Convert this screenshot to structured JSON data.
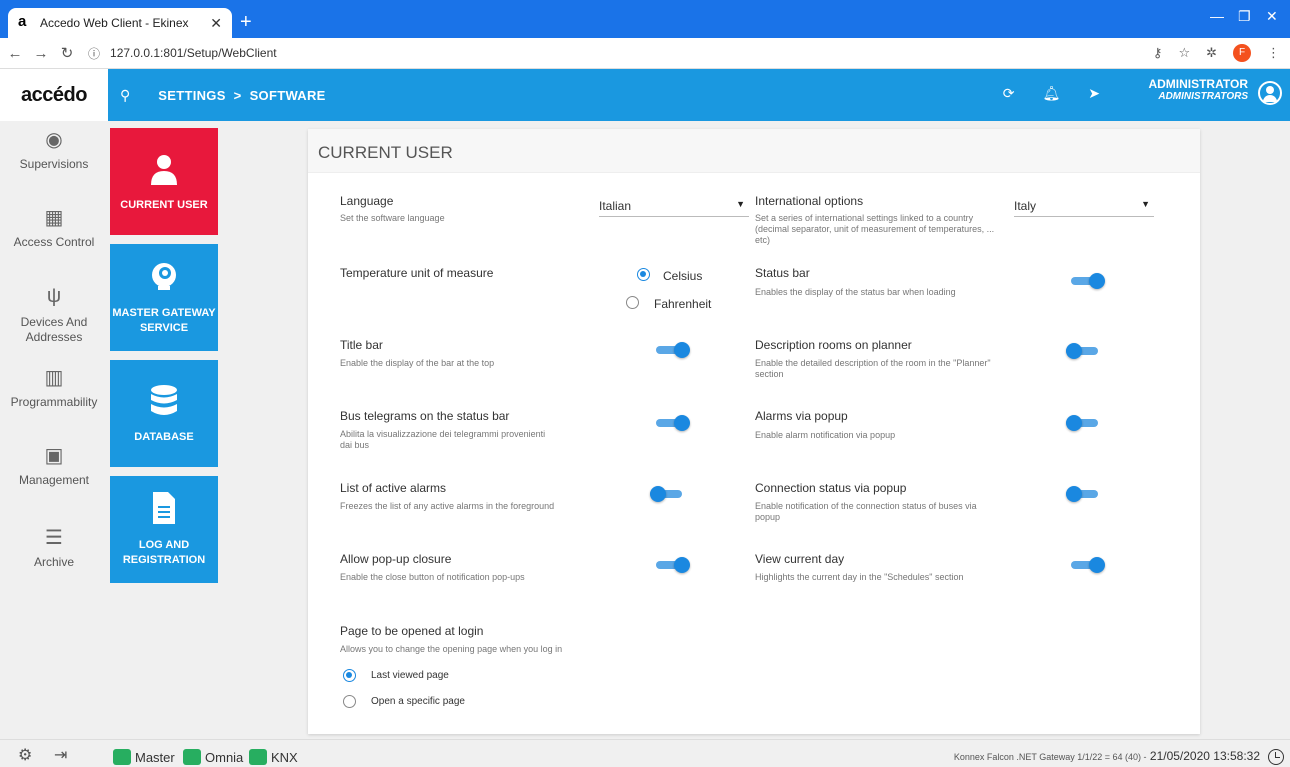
{
  "browser": {
    "tab_title": "Accedo Web Client - Ekinex",
    "url": "127.0.0.1:801/Setup/WebClient",
    "profile_initial": "F"
  },
  "header": {
    "logo": "accédo",
    "breadcrumb": [
      "SETTINGS",
      "SOFTWARE"
    ],
    "user_name": "ADMINISTRATOR",
    "user_role": "ADMINISTRATORS"
  },
  "sidebar": {
    "items": [
      {
        "label": "Supervisions",
        "icon": "eye-icon"
      },
      {
        "label": "Access Control",
        "icon": "building-icon"
      },
      {
        "label": "Devices And Addresses",
        "icon": "usb-icon"
      },
      {
        "label": "Programmability",
        "icon": "chart-icon"
      },
      {
        "label": "Management",
        "icon": "badge-icon"
      },
      {
        "label": "Archive",
        "icon": "database-icon"
      }
    ]
  },
  "tiles": [
    {
      "label": "CURRENT USER",
      "color": "#e8183c",
      "icon": "user-icon"
    },
    {
      "label": "MASTER GATEWAY SERVICE",
      "color": "#1a98e0",
      "icon": "gateway-icon"
    },
    {
      "label": "DATABASE",
      "color": "#1a98e0",
      "icon": "database-icon"
    },
    {
      "label": "LOG AND REGISTRATION",
      "color": "#1a98e0",
      "icon": "document-icon"
    }
  ],
  "panel": {
    "title": "CURRENT USER",
    "language": {
      "label": "Language",
      "desc": "Set the software language",
      "value": "Italian"
    },
    "intl": {
      "label": "International options",
      "desc": "Set a series of international settings linked to a country (decimal separator, unit of measurement of temperatures, ... etc)",
      "value": "Italy"
    },
    "temp": {
      "label": "Temperature unit of measure",
      "options": [
        "Celsius",
        "Fahrenheit"
      ],
      "selected": "Celsius"
    },
    "status_bar": {
      "label": "Status bar",
      "desc": "Enables the display of the status bar when loading",
      "on": true
    },
    "title_bar": {
      "label": "Title bar",
      "desc": "Enable the display of the bar at the top",
      "on": true
    },
    "desc_rooms": {
      "label": "Description rooms on planner",
      "desc": "Enable the detailed description of the room in the \"Planner\" section",
      "on": false
    },
    "bus_tel": {
      "label": "Bus telegrams on the status bar",
      "desc": "Abilita la visualizzazione dei telegrammi provenienti dai bus",
      "on": true
    },
    "alarms_popup": {
      "label": "Alarms via popup",
      "desc": "Enable alarm notification via popup",
      "on": false
    },
    "active_alarms": {
      "label": "List of active alarms",
      "desc": "Freezes the list of any active alarms in the foreground",
      "on": false
    },
    "conn_status": {
      "label": "Connection status via popup",
      "desc": "Enable notification of the connection status of buses via popup",
      "on": false
    },
    "popup_close": {
      "label": "Allow pop-up closure",
      "desc": "Enable the close button of notification pop-ups",
      "on": true
    },
    "current_day": {
      "label": "View current day",
      "desc": "Highlights the current day in the \"Schedules\" section",
      "on": true
    },
    "login_page": {
      "label": "Page to be opened at login",
      "desc": "Allows you to change the opening page when you log in",
      "options": [
        "Last viewed page",
        "Open a specific page"
      ],
      "selected": "Last viewed page"
    }
  },
  "footer": {
    "buses": [
      "Master",
      "Omnia",
      "KNX"
    ],
    "gateway_info": "Konnex Falcon .NET Gateway 1/1/22 = 64 (40) -",
    "datetime": "21/05/2020 13:58:32"
  }
}
